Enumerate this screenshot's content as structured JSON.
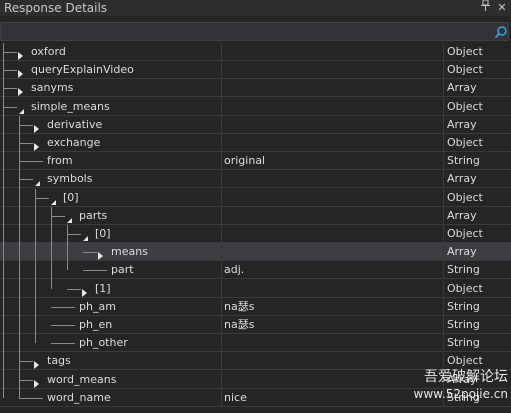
{
  "panel": {
    "title": "Response Details",
    "pin_icon": "pin-icon",
    "close_icon": "close-icon"
  },
  "search": {
    "value": "",
    "placeholder": "",
    "icon": "search-icon"
  },
  "rows": [
    {
      "name": "oxford",
      "value": "",
      "type": "Object",
      "expander": "collapsed"
    },
    {
      "name": "queryExplainVideo",
      "value": "",
      "type": "Object",
      "expander": "collapsed"
    },
    {
      "name": "sanyms",
      "value": "",
      "type": "Array",
      "expander": "collapsed"
    },
    {
      "name": "simple_means",
      "value": "",
      "type": "Object",
      "expander": "expanded"
    },
    {
      "name": "derivative",
      "value": "",
      "type": "Array",
      "expander": "collapsed"
    },
    {
      "name": "exchange",
      "value": "",
      "type": "Object",
      "expander": "collapsed"
    },
    {
      "name": "from",
      "value": "original",
      "type": "String",
      "expander": "none"
    },
    {
      "name": "symbols",
      "value": "",
      "type": "Array",
      "expander": "expanded"
    },
    {
      "name": "[0]",
      "value": "",
      "type": "Object",
      "expander": "expanded"
    },
    {
      "name": "parts",
      "value": "",
      "type": "Array",
      "expander": "expanded"
    },
    {
      "name": "[0]",
      "value": "",
      "type": "Object",
      "expander": "expanded"
    },
    {
      "name": "means",
      "value": "",
      "type": "Array",
      "expander": "collapsed",
      "selected": true
    },
    {
      "name": "part",
      "value": "adj.",
      "type": "String",
      "expander": "none"
    },
    {
      "name": "[1]",
      "value": "",
      "type": "Object",
      "expander": "collapsed"
    },
    {
      "name": "ph_am",
      "value": "na瑟s",
      "type": "String",
      "expander": "none"
    },
    {
      "name": "ph_en",
      "value": "na瑟s",
      "type": "String",
      "expander": "none"
    },
    {
      "name": "ph_other",
      "value": "",
      "type": "String",
      "expander": "none"
    },
    {
      "name": "tags",
      "value": "",
      "type": "Object",
      "expander": "collapsed"
    },
    {
      "name": "word_means",
      "value": "",
      "type": "Array",
      "expander": "collapsed"
    },
    {
      "name": "word_name",
      "value": "nice",
      "type": "String",
      "expander": "none"
    }
  ],
  "watermark": {
    "line1": "吾爱破解论坛",
    "line2": "www.52pojie.cn"
  }
}
